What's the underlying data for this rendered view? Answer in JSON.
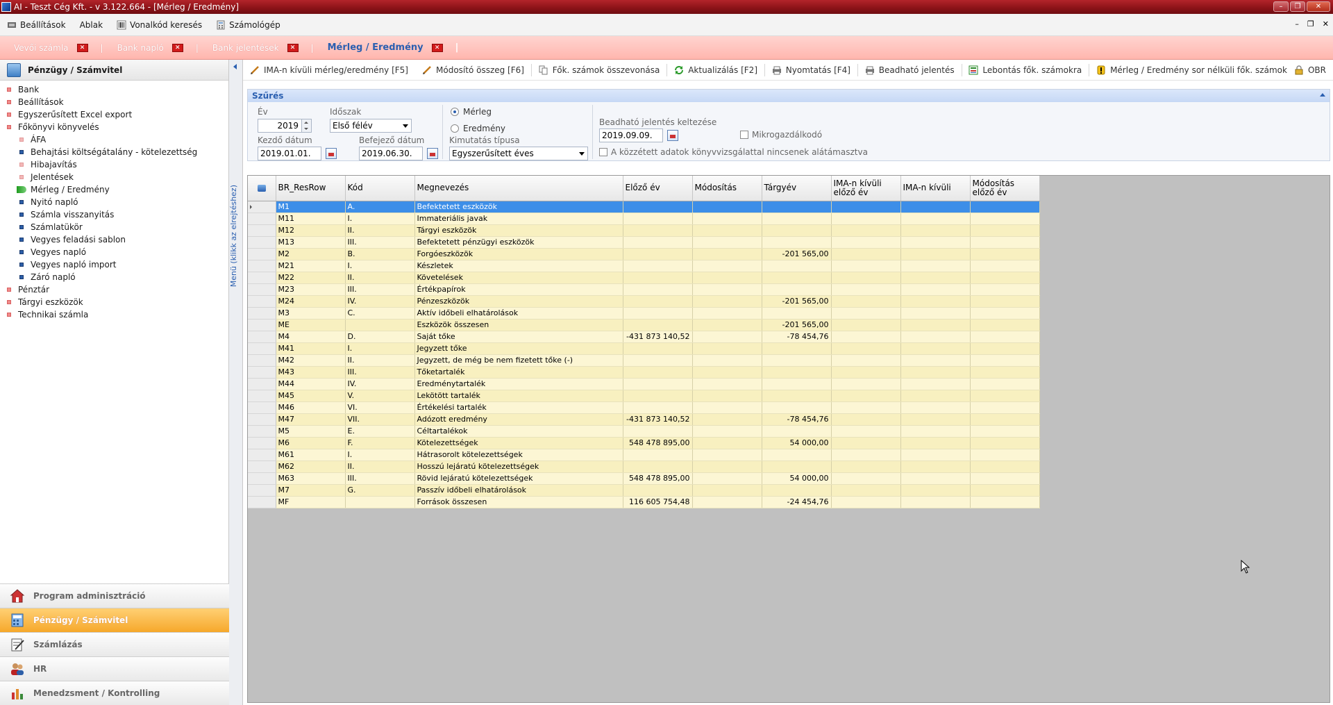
{
  "window": {
    "title": "AI - Teszt Cég Kft. - v 3.122.664 - [Mérleg / Eredmény]",
    "controls": [
      "–",
      "❐",
      "✕"
    ]
  },
  "menubar": {
    "items": [
      {
        "label": "Beállítások",
        "icon": "settings-icon"
      },
      {
        "label": "Ablak",
        "icon": ""
      },
      {
        "label": "Vonalkód keresés",
        "icon": "barcode-icon"
      },
      {
        "label": "Számológép",
        "icon": "calculator-icon"
      }
    ],
    "mdi_controls": [
      "–",
      "❐",
      "✕"
    ]
  },
  "tabs": [
    {
      "label": "Vevői számla",
      "active": false
    },
    {
      "label": "Bank napló",
      "active": false
    },
    {
      "label": "Bank jelentések",
      "active": false
    },
    {
      "label": "Mérleg / Eredmény",
      "active": true
    }
  ],
  "left_panel": {
    "header": "Pénzügy / Számvitel",
    "tree": [
      {
        "label": "Bank",
        "level": 1
      },
      {
        "label": "Beállítások",
        "level": 1
      },
      {
        "label": "Egyszerűsített Excel export",
        "level": 1
      },
      {
        "label": "Főkönyvi könyvelés",
        "level": 1
      },
      {
        "label": "ÁFA",
        "level": 2,
        "pink": true
      },
      {
        "label": "Behajtási költségátalány - kötelezettség",
        "level": 2
      },
      {
        "label": "Hibajavítás",
        "level": 2,
        "pink": true
      },
      {
        "label": "Jelentések",
        "level": 2,
        "pink": true
      },
      {
        "label": "Mérleg / Eredmény",
        "level": 2,
        "selected": true
      },
      {
        "label": "Nyitó napló",
        "level": 2
      },
      {
        "label": "Számla visszanyitás",
        "level": 2
      },
      {
        "label": "Számlatükör",
        "level": 2
      },
      {
        "label": "Vegyes feladási sablon",
        "level": 2
      },
      {
        "label": "Vegyes napló",
        "level": 2
      },
      {
        "label": "Vegyes napló import",
        "level": 2
      },
      {
        "label": "Záró napló",
        "level": 2
      },
      {
        "label": "Pénztár",
        "level": 1
      },
      {
        "label": "Tárgyi eszközök",
        "level": 1
      },
      {
        "label": "Technikai számla",
        "level": 1
      }
    ],
    "nav": [
      {
        "label": "Program adminisztráció",
        "active": false
      },
      {
        "label": "Pénzügy / Számvitel",
        "active": true
      },
      {
        "label": "Számlázás",
        "active": false
      },
      {
        "label": "HR",
        "active": false
      },
      {
        "label": "Menedzsment / Kontrolling",
        "active": false
      }
    ],
    "vertical_label": "Menü (klikk az elrejtéshez)"
  },
  "toolbar": [
    {
      "label": "IMA-n kívüli mérleg/eredmény [F5]",
      "icon": "pencil-icon"
    },
    {
      "label": "Módosító összeg [F6]",
      "icon": "pencil-icon"
    },
    {
      "label": "Fők. számok összevonása",
      "icon": "merge-icon"
    },
    {
      "label": "Aktualizálás [F2]",
      "icon": "refresh-icon"
    },
    {
      "label": "Nyomtatás [F4]",
      "icon": "printer-icon"
    },
    {
      "label": "Beadható jelentés",
      "icon": "printer-icon"
    },
    {
      "label": "Lebontás fők. számokra",
      "icon": "breakdown-icon"
    },
    {
      "label": "Mérleg / Eredmény sor nélküli fők. számok",
      "icon": "warning-icon"
    },
    {
      "label": "OBR",
      "icon": "lock-icon"
    }
  ],
  "filter": {
    "title": "Szűrés",
    "ev_label": "Év",
    "ev_value": "2019",
    "idoszak_label": "Időszak",
    "idoszak_value": "Első félév",
    "kezdo_label": "Kezdő dátum",
    "kezdo_value": "2019.01.01.",
    "befejezo_label": "Befejező dátum",
    "befejezo_value": "2019.06.30.",
    "radio_merleg": "Mérleg",
    "radio_eredmeny": "Eredmény",
    "kimutatas_label": "Kimutatás típusa",
    "kimutatas_value": "Egyszerűsített éves",
    "beadhato_label": "Beadható jelentés keltezése",
    "beadhato_value": "2019.09.09.",
    "mikro_label": "Mikrogazdálkodó",
    "kozzetett_label": "A közzétett adatok könyvvizsgálattal nincsenek alátámasztva"
  },
  "grid": {
    "columns": [
      "BR_ResRow",
      "Kód",
      "Megnevezés",
      "Előző év",
      "Módosítás",
      "Tárgyév",
      "IMA-n kívüli előző év",
      "IMA-n kívüli",
      "Módosítás előző év"
    ],
    "rows": [
      [
        "M1",
        "A.",
        "Befektetett eszközök",
        "",
        "",
        "",
        "",
        "",
        ""
      ],
      [
        "M11",
        "I.",
        "Immateriális javak",
        "",
        "",
        "",
        "",
        "",
        ""
      ],
      [
        "M12",
        "II.",
        "Tárgyi eszközök",
        "",
        "",
        "",
        "",
        "",
        ""
      ],
      [
        "M13",
        "III.",
        "Befektetett pénzügyi eszközök",
        "",
        "",
        "",
        "",
        "",
        ""
      ],
      [
        "M2",
        "B.",
        "Forgóeszközök",
        "",
        "",
        "-201 565,00",
        "",
        "",
        ""
      ],
      [
        "M21",
        "I.",
        "Készletek",
        "",
        "",
        "",
        "",
        "",
        ""
      ],
      [
        "M22",
        "II.",
        "Követelések",
        "",
        "",
        "",
        "",
        "",
        ""
      ],
      [
        "M23",
        "III.",
        "Értékpapírok",
        "",
        "",
        "",
        "",
        "",
        ""
      ],
      [
        "M24",
        "IV.",
        "Pénzeszközök",
        "",
        "",
        "-201 565,00",
        "",
        "",
        ""
      ],
      [
        "M3",
        "C.",
        "Aktív időbeli elhatárolások",
        "",
        "",
        "",
        "",
        "",
        ""
      ],
      [
        "ME",
        "",
        "Eszközök összesen",
        "",
        "",
        "-201 565,00",
        "",
        "",
        ""
      ],
      [
        "M4",
        "D.",
        "Saját tőke",
        "-431 873 140,52",
        "",
        "-78 454,76",
        "",
        "",
        ""
      ],
      [
        "M41",
        "I.",
        "Jegyzett tőke",
        "",
        "",
        "",
        "",
        "",
        ""
      ],
      [
        "M42",
        "II.",
        "Jegyzett, de még be nem fizetett tőke (-)",
        "",
        "",
        "",
        "",
        "",
        ""
      ],
      [
        "M43",
        "III.",
        "Tőketartalék",
        "",
        "",
        "",
        "",
        "",
        ""
      ],
      [
        "M44",
        "IV.",
        "Eredménytartalék",
        "",
        "",
        "",
        "",
        "",
        ""
      ],
      [
        "M45",
        "V.",
        "Lekötött tartalék",
        "",
        "",
        "",
        "",
        "",
        ""
      ],
      [
        "M46",
        "VI.",
        "Értékelési tartalék",
        "",
        "",
        "",
        "",
        "",
        ""
      ],
      [
        "M47",
        "VII.",
        "Adózott eredmény",
        "-431 873 140,52",
        "",
        "-78 454,76",
        "",
        "",
        ""
      ],
      [
        "M5",
        "E.",
        "Céltartalékok",
        "",
        "",
        "",
        "",
        "",
        ""
      ],
      [
        "M6",
        "F.",
        "Kötelezettségek",
        "548 478 895,00",
        "",
        "54 000,00",
        "",
        "",
        ""
      ],
      [
        "M61",
        "I.",
        "Hátrasorolt kötelezettségek",
        "",
        "",
        "",
        "",
        "",
        ""
      ],
      [
        "M62",
        "II.",
        "Hosszú lejáratú kötelezettségek",
        "",
        "",
        "",
        "",
        "",
        ""
      ],
      [
        "M63",
        "III.",
        "Rövid lejáratú kötelezettségek",
        "548 478 895,00",
        "",
        "54 000,00",
        "",
        "",
        ""
      ],
      [
        "M7",
        "G.",
        "Passzív időbeli elhatárolások",
        "",
        "",
        "",
        "",
        "",
        ""
      ],
      [
        "MF",
        "",
        "Források összesen",
        "116 605 754,48",
        "",
        "-24 454,76",
        "",
        "",
        ""
      ]
    ]
  }
}
